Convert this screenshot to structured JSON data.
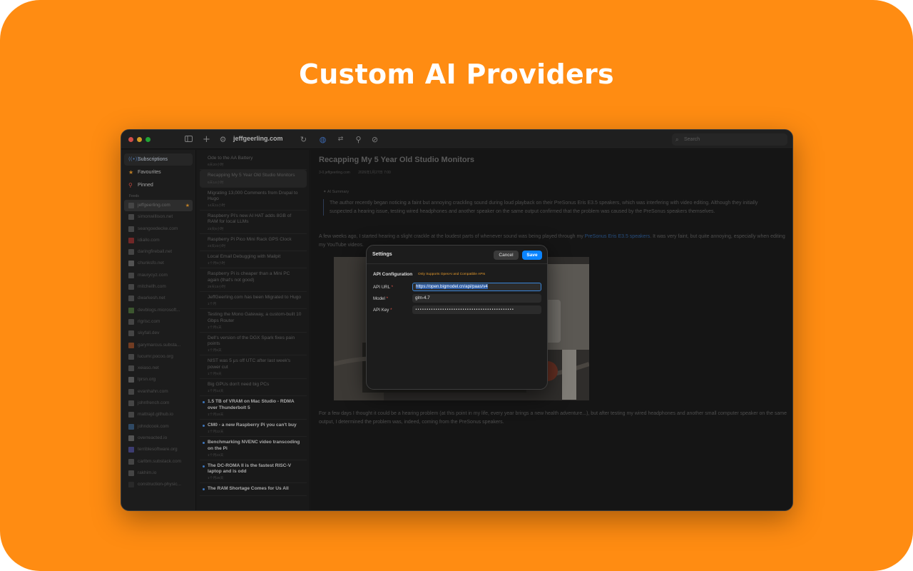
{
  "hero": {
    "title": "Custom AI Providers"
  },
  "colors": {
    "background": "#ff8c12",
    "accent": "#0a84ff",
    "warning": "#e59a2c",
    "required": "#e0554a"
  },
  "toolbar": {
    "sidebar_toggle_icon": "sidebar-icon",
    "add_icon": "plus-icon",
    "settings_icon": "gear-icon",
    "domain": "jeffgeerling.com",
    "refresh_icon": "refresh-icon",
    "tool_icons": [
      "globe-icon",
      "translate-icon",
      "pin-icon",
      "compass-icon"
    ],
    "search_placeholder": "Search"
  },
  "sidebar": {
    "nav": [
      {
        "label": "Subscriptions",
        "icon": "feed-icon",
        "glyph": "⟪⟫"
      },
      {
        "label": "Favourites",
        "icon": "star-icon",
        "glyph": "★"
      },
      {
        "label": "Pinned",
        "icon": "pin-icon",
        "glyph": "📌"
      }
    ],
    "feeds_header": "Feeds",
    "feeds": [
      "jeffgeerling.com",
      "simonwillison.net",
      "seangoedecke.com",
      "idiallo.com",
      "daringfireball.net",
      "chunksfo.net",
      "maurycyz.com",
      "mitchellh.com",
      "dwarkesh.net",
      "devblogs.microsoft...",
      "rlgrisc.com",
      "skyfall.dev",
      "garymarcus.substa...",
      "lucumr.pocoo.org",
      "xeiaso.net",
      "lprsn.org",
      "evanhahn.com",
      "johnfrench.com",
      "mattrajd.github.io",
      "johndcook.com",
      "overreacted.io",
      "terriblesoftware.org",
      "carlbm.substack.com",
      "rakhim.io",
      "construction-physic..."
    ]
  },
  "articles": [
    {
      "title": "Ode to the AA Battery",
      "date": "6天20小时"
    },
    {
      "title": "Recapping My 5 Year Old Studio Monitors",
      "date": "6天14小时"
    },
    {
      "title": "Migrating 13,000 Comments from Drupal to Hugo",
      "date": "14天11小时"
    },
    {
      "title": "Raspberry Pi's new AI HAT adds 8GB of RAM for local LLMs",
      "date": "23天5小时"
    },
    {
      "title": "Raspberry Pi Pico Mini Rack GPS Clock",
      "date": "23天23小时"
    },
    {
      "title": "Local Email Debugging with Mailpit",
      "date": "1个月9小时"
    },
    {
      "title": "Raspberry Pi is cheaper than a Mini PC again (that's not good)",
      "date": "29天15小时"
    },
    {
      "title": "JeffGeerling.com has been Migrated to Hugo",
      "date": "1个月"
    },
    {
      "title": "Testing the Mono Gateway, a custom-built 10 Gbps Router",
      "date": "1个月1天"
    },
    {
      "title": "Dell's version of the DGX Spark fixes pain points",
      "date": "1个月8天"
    },
    {
      "title": "NIST was 5 μs off UTC after last week's power cut",
      "date": "1个月9天"
    },
    {
      "title": "Big GPUs don't need big PCs",
      "date": "1个月14天"
    },
    {
      "title": "1.5 TB of VRAM on Mac Studio - RDMA over Thunderbolt 5",
      "date": "1个月19天"
    },
    {
      "title": "CM0 - a new Raspberry Pi you can't buy",
      "date": "1个月22天"
    },
    {
      "title": "Benchmarking NVENC video transcoding on the Pi",
      "date": "1个月23天"
    },
    {
      "title": "The DC-ROMA II is the fastest RISC-V laptop and is odd",
      "date": "1个月26天"
    },
    {
      "title": "The RAM Shortage Comes for Us All",
      "date": ""
    }
  ],
  "article": {
    "title": "Recapping My 5 Year Old Studio Monitors",
    "source": "3-0.jeffgeerling.com",
    "date": "2026年1月27日 7:00",
    "ai_label": "AI Summary",
    "ai_summary": "The author recently began noticing a faint but annoying crackling sound during loud playback on their PreSonus Eris E3.5 speakers, which was interfering with video editing. Although they initially suspected a hearing issue, testing wired headphones and another speaker on the same output confirmed that the problem was caused by the PreSonus speakers themselves.",
    "para1_before": "A few weeks ago, I started hearing a slight crackle at the loudest parts of whenever sound was being played through my ",
    "para1_link": "PreSonus Eris E3.5 speakers",
    "para1_after": ". It was very faint, but quite annoying, especially when editing my YouTube videos.",
    "para2": "For a few days I thought it could be a hearing problem (at this point in my life, every year brings a new health adventure...), but after testing my wired headphones and another small computer speaker on the same output, I determined the problem was, indeed, coming from the PreSonus speakers."
  },
  "dialog": {
    "title": "Settings",
    "cancel": "Cancel",
    "save": "Save",
    "section": "API Configuration",
    "note": "Only Supports OpenAI and Compatible APIs",
    "fields": [
      {
        "label": "API URL",
        "value": "https://open.bigmodel.cn/api/paas/v4"
      },
      {
        "label": "Model",
        "value": "glm-4.7"
      },
      {
        "label": "API Key",
        "value": "••••••••••••••••••••••••••••••••••••••••••••"
      }
    ],
    "required_mark": "*"
  }
}
